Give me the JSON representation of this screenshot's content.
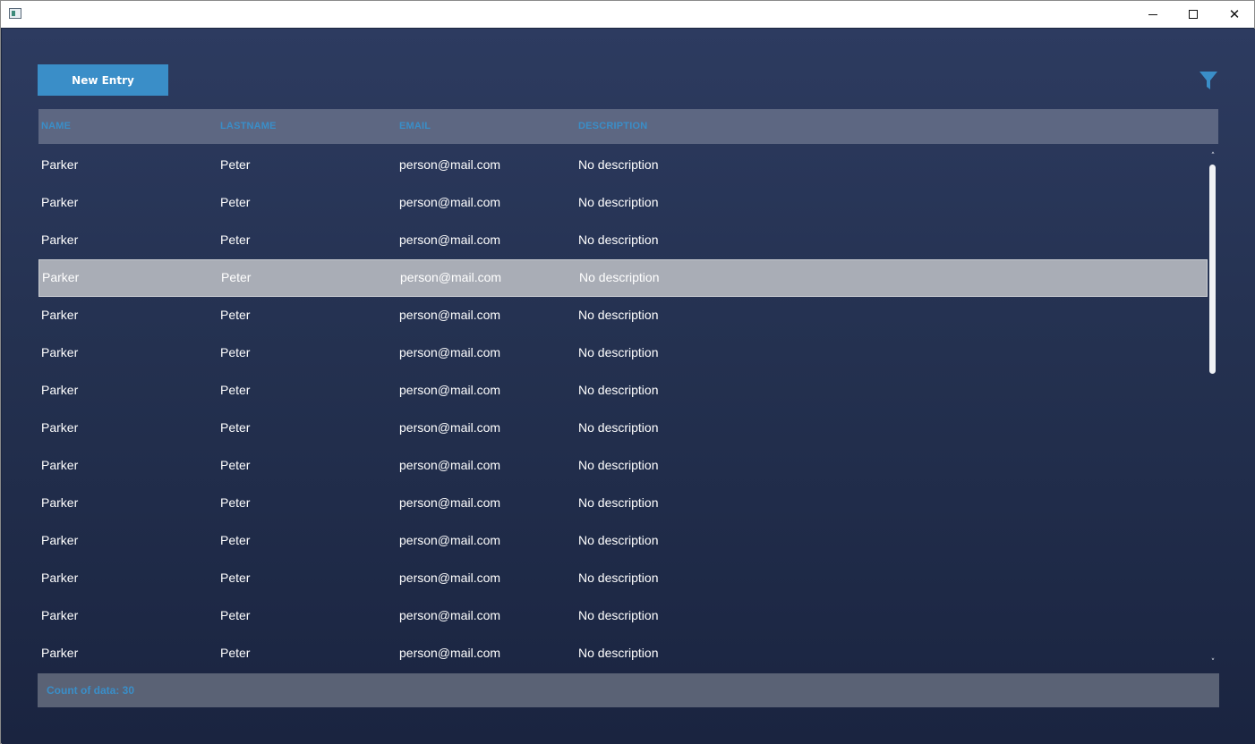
{
  "window": {
    "minimize_glyph": "",
    "close_glyph": "✕"
  },
  "toolbar": {
    "new_entry_label": "New Entry",
    "filter_icon": "filter-icon"
  },
  "table": {
    "columns": [
      "NAME",
      "LASTNAME",
      "EMAIL",
      "DESCRIPTION"
    ],
    "rows": [
      {
        "name": "Parker",
        "lastname": "Peter",
        "email": "person@mail.com",
        "description": "No description"
      },
      {
        "name": "Parker",
        "lastname": "Peter",
        "email": "person@mail.com",
        "description": "No description"
      },
      {
        "name": "Parker",
        "lastname": "Peter",
        "email": "person@mail.com",
        "description": "No description"
      },
      {
        "name": "Parker",
        "lastname": "Peter",
        "email": "person@mail.com",
        "description": "No description",
        "selected": true
      },
      {
        "name": "Parker",
        "lastname": "Peter",
        "email": "person@mail.com",
        "description": "No description"
      },
      {
        "name": "Parker",
        "lastname": "Peter",
        "email": "person@mail.com",
        "description": "No description"
      },
      {
        "name": "Parker",
        "lastname": "Peter",
        "email": "person@mail.com",
        "description": "No description"
      },
      {
        "name": "Parker",
        "lastname": "Peter",
        "email": "person@mail.com",
        "description": "No description"
      },
      {
        "name": "Parker",
        "lastname": "Peter",
        "email": "person@mail.com",
        "description": "No description"
      },
      {
        "name": "Parker",
        "lastname": "Peter",
        "email": "person@mail.com",
        "description": "No description"
      },
      {
        "name": "Parker",
        "lastname": "Peter",
        "email": "person@mail.com",
        "description": "No description"
      },
      {
        "name": "Parker",
        "lastname": "Peter",
        "email": "person@mail.com",
        "description": "No description"
      },
      {
        "name": "Parker",
        "lastname": "Peter",
        "email": "person@mail.com",
        "description": "No description"
      },
      {
        "name": "Parker",
        "lastname": "Peter",
        "email": "person@mail.com",
        "description": "No description"
      }
    ]
  },
  "scrollbar": {
    "up_glyph": "˄",
    "down_glyph": "˅"
  },
  "footer": {
    "count_text": "Count of data:  30"
  },
  "colors": {
    "accent": "#3a8ec8",
    "header_bg": "#5d6782",
    "selected_row": "#a9adb6"
  }
}
